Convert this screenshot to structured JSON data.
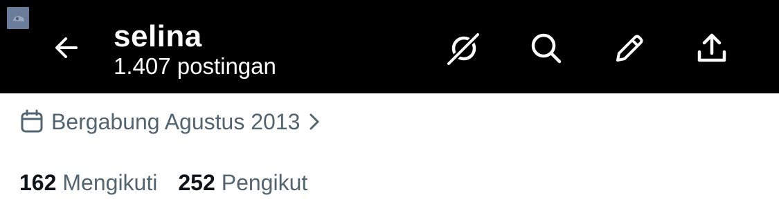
{
  "header": {
    "title": "selina",
    "subtitle": "1.407 postingan"
  },
  "profile": {
    "joined_text": "Bergabung Agustus 2013",
    "following_count": "162",
    "following_label": "Mengikuti",
    "followers_count": "252",
    "followers_label": "Pengikut"
  },
  "icons": {
    "back": "arrow-left-icon",
    "grok": "grok-icon",
    "search": "search-icon",
    "compose": "pencil-icon",
    "share": "share-upload-icon",
    "calendar": "calendar-icon",
    "chevron": "chevron-right-icon"
  },
  "colors": {
    "header_bg": "#000000",
    "header_text": "#ffffff",
    "secondary_text": "#536471",
    "primary_text": "#0f1419"
  }
}
